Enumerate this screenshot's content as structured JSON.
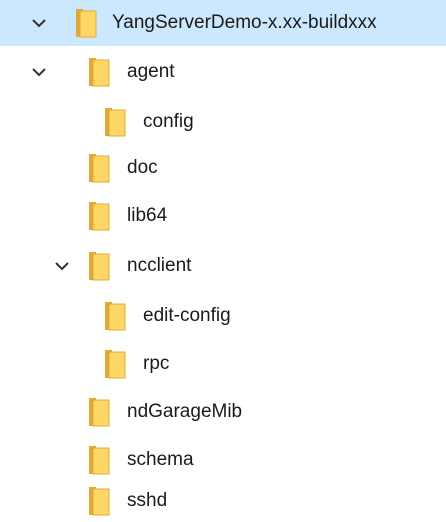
{
  "tree": {
    "items": [
      {
        "label": "YangServerDemo-x.xx-buildxxx",
        "expanded": true,
        "selected": true
      },
      {
        "label": "agent",
        "expanded": true
      },
      {
        "label": "config"
      },
      {
        "label": "doc"
      },
      {
        "label": "lib64"
      },
      {
        "label": "ncclient",
        "expanded": true
      },
      {
        "label": "edit-config"
      },
      {
        "label": "rpc"
      },
      {
        "label": "ndGarageMib"
      },
      {
        "label": "schema"
      },
      {
        "label": "sshd"
      }
    ],
    "icons": {
      "folder": "folder-icon",
      "chevron": "chevron-down-icon"
    },
    "colors": {
      "selection": "#cce8ff",
      "folder_body": "#ffd766",
      "folder_edge": "#e0a936",
      "chevron": "#333333"
    }
  }
}
